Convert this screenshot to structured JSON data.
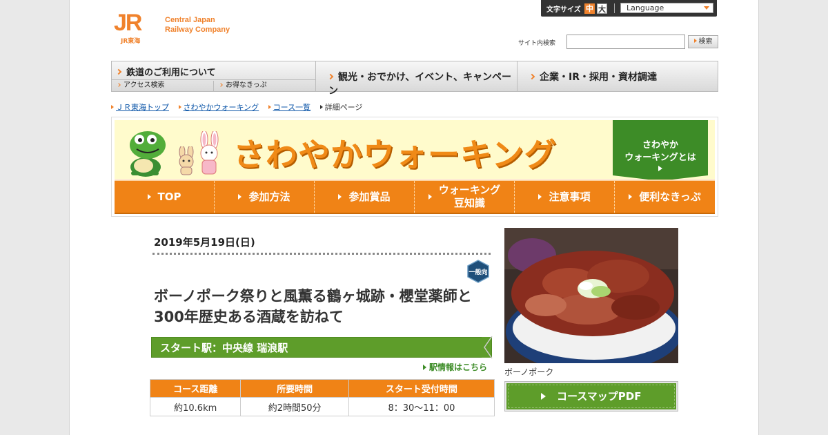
{
  "header": {
    "logo_jr": "JR",
    "logo_sub": "JR東海",
    "logo_name": "Central Japan\nRailway Company",
    "font_size_label": "文字サイズ",
    "font_mid": "中",
    "font_big": "大",
    "language_label": "Language",
    "search_label": "サイト内検索",
    "search_value": "",
    "search_button": "検索"
  },
  "global_nav": {
    "railway": "鉄道のご利用について",
    "access": "アクセス検索",
    "tickets": "お得なきっぷ",
    "sightseeing": "観光・おでかけ、イベント、キャンペーン",
    "corporate": "企業・IR・採用・資材調達"
  },
  "breadcrumb": [
    {
      "label": "ＪＲ東海トップ",
      "link": true
    },
    {
      "label": "さわやかウォーキング",
      "link": true
    },
    {
      "label": "コース一覧",
      "link": true
    },
    {
      "label": "詳細ページ",
      "link": false
    }
  ],
  "banner": {
    "title": "さわやかウォーキング",
    "about": "さわやか\nウォーキングとは"
  },
  "walking_nav": [
    "TOP",
    "参加方法",
    "参加賞品",
    "ウォーキング\n豆知識",
    "注意事項",
    "便利なきっぷ"
  ],
  "course": {
    "date": "2019年5月19日(日)",
    "badge": "一般向",
    "title": "ボーノポーク祭りと風薫る鶴ヶ城跡・櫻堂薬師と300年歴史ある酒蔵を訪ねて",
    "start_station": "スタート駅：中央線 瑞浪駅",
    "station_link": "駅情報はこちら",
    "table_headers": [
      "コース距離",
      "所要時間",
      "スタート受付時間"
    ],
    "table_values": [
      "約10.6km",
      "約2時間50分",
      "8：30～11：00"
    ],
    "photo_caption": "ボーノポーク",
    "map_button": "コースマップPDF"
  },
  "colors": {
    "jr_orange": "#f0822c",
    "walking_orange": "#f08316",
    "walking_green": "#5e9d2a"
  }
}
